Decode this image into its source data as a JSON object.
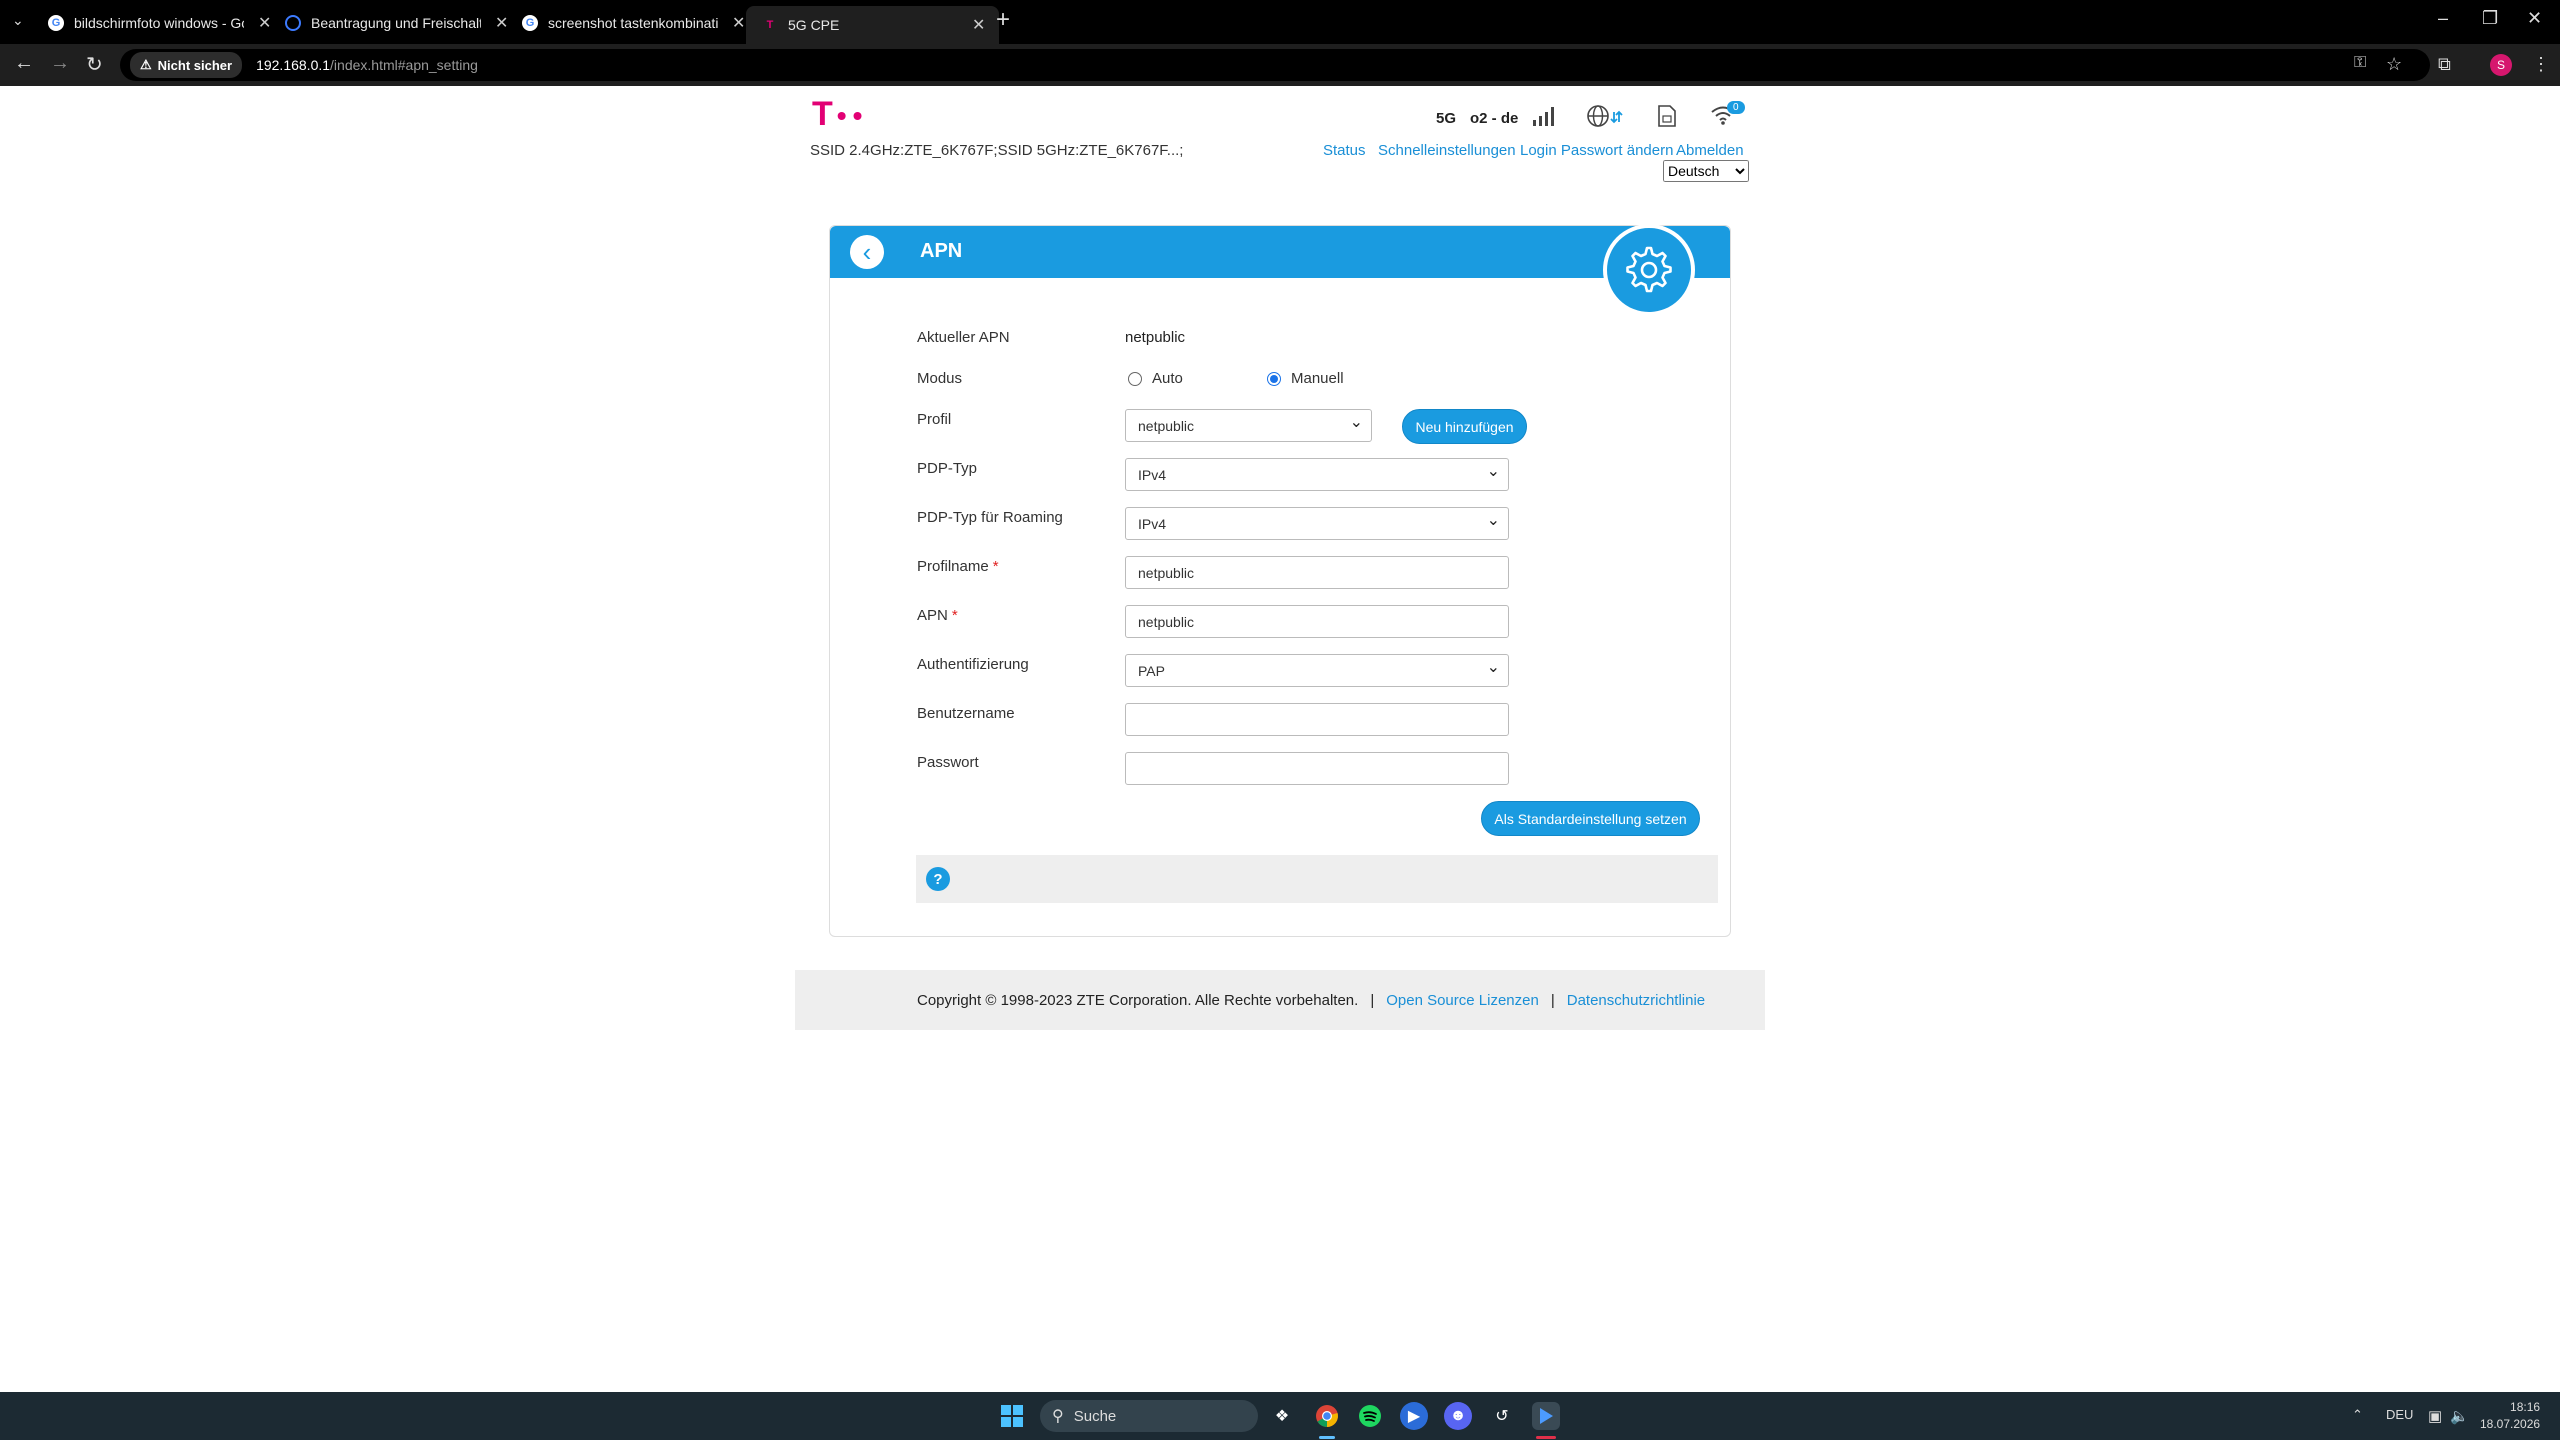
{
  "browser": {
    "tabs": [
      {
        "title": "bildschirmfoto windows - Goog",
        "icon": "google-icon",
        "active": false
      },
      {
        "title": "Beantragung und Freischaltung",
        "icon": "search-o-icon",
        "active": false
      },
      {
        "title": "screenshot tastenkombination",
        "icon": "google-icon",
        "active": false
      },
      {
        "title": "5G CPE",
        "icon": "telekom-icon",
        "active": true
      }
    ],
    "security_label": "Nicht sicher",
    "url_host": "192.168.0.1",
    "url_path": "/index.html#apn_setting",
    "profile_initial": "S"
  },
  "header": {
    "ssid": "SSID 2.4GHz:ZTE_6K767F;SSID 5GHz:ZTE_6K767F...;",
    "network_type": "5G",
    "provider": "o2 - de",
    "wifi_clients": "0",
    "nav": [
      "Status",
      "Schnelleinstellungen",
      "Login Passwort ändern",
      "Abmelden"
    ],
    "language": "Deutsch"
  },
  "card": {
    "title": "APN",
    "fields": {
      "current_apn_label": "Aktueller APN",
      "current_apn_value": "netpublic",
      "mode_label": "Modus",
      "mode_auto": "Auto",
      "mode_manual": "Manuell",
      "profile_label": "Profil",
      "profile_value": "netpublic",
      "add_new_label": "Neu hinzufügen",
      "pdp_type_label": "PDP-Typ",
      "pdp_type_value": "IPv4",
      "pdp_roaming_label": "PDP-Typ für Roaming",
      "pdp_roaming_value": "IPv4",
      "profile_name_label": "Profilname",
      "profile_name_value": "netpublic",
      "apn_label": "APN",
      "apn_value": "netpublic",
      "auth_label": "Authentifizierung",
      "auth_value": "PAP",
      "username_label": "Benutzername",
      "username_value": "",
      "password_label": "Passwort",
      "password_value": "",
      "required_mark": "*"
    },
    "set_default_label": "Als Standardeinstellung setzen",
    "help_symbol": "?"
  },
  "footer": {
    "copyright": "Copyright © 1998-2023 ZTE Corporation. Alle Rechte vorbehalten.",
    "separator": "|",
    "open_source": "Open Source Lizenzen",
    "privacy": "Datenschutzrichtlinie"
  },
  "taskbar": {
    "search_placeholder": "Suche",
    "language": "DEU",
    "time": "18:16",
    "date": "18.07.2026"
  }
}
